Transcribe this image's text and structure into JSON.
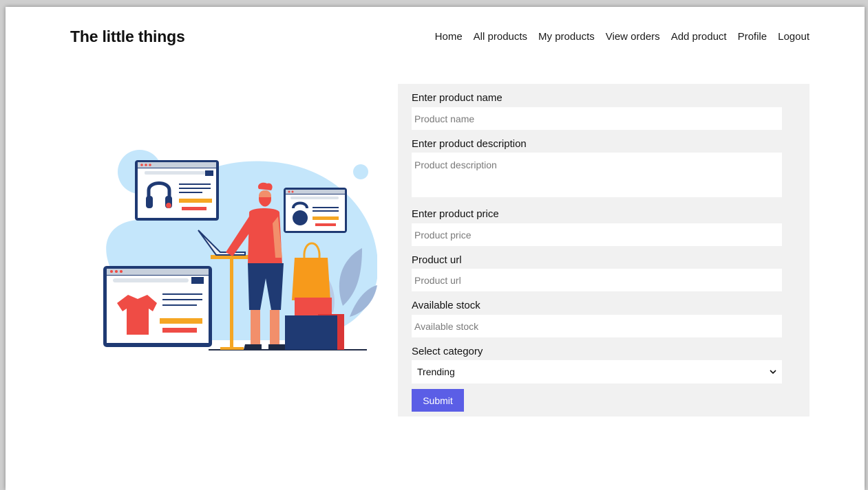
{
  "brand": "The little things",
  "nav": {
    "home": "Home",
    "all_products": "All products",
    "my_products": "My products",
    "view_orders": "View orders",
    "add_product": "Add product",
    "profile": "Profile",
    "logout": "Logout"
  },
  "form": {
    "name_label": "Enter product name",
    "name_placeholder": "Product name",
    "description_label": "Enter product description",
    "description_placeholder": "Product description",
    "price_label": "Enter product price",
    "price_placeholder": "Product price",
    "url_label": "Product url",
    "url_placeholder": "Product url",
    "stock_label": "Available stock",
    "stock_placeholder": "Available stock",
    "category_label": "Select category",
    "category_selected": "Trending",
    "submit_label": "Submit"
  },
  "colors": {
    "accent": "#5b5ee6",
    "panel": "#f1f1f1",
    "illustration_blue": "#c4e6fb",
    "shirt_red": "#ef4c45",
    "box_navy": "#1f3a73"
  }
}
